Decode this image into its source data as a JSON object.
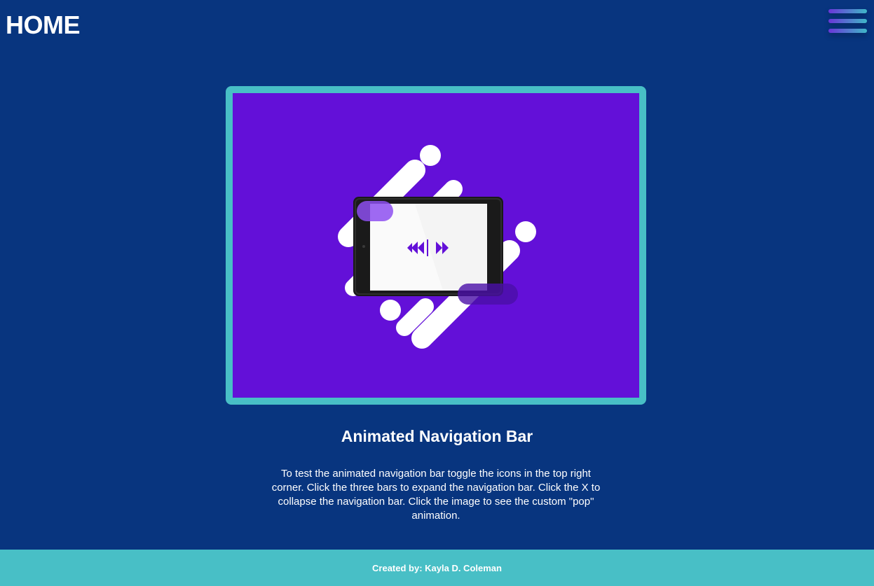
{
  "header": {
    "title": "HOME",
    "menu_icon": "hamburger-menu-icon"
  },
  "card": {
    "image_icon": "tablet-media-player-illustration",
    "title": "Animated Navigation Bar",
    "description": "To test the animated navigation bar toggle the icons in the top right corner. Click the three bars to expand the navigation bar. Click the X to collapse the navigation bar. Click the image to see the custom \"pop\" animation."
  },
  "footer": {
    "credit": "Created by: Kayla D. Coleman"
  },
  "colors": {
    "background": "#08357f",
    "accent": "#48bfc6",
    "image_background": "#6310d8",
    "text": "#ffffff"
  }
}
